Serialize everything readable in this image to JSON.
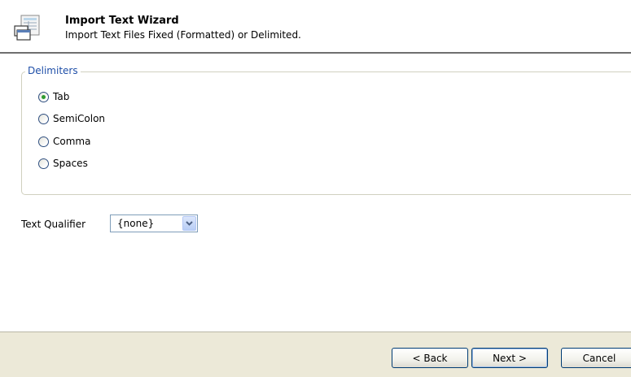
{
  "header": {
    "title": "Import Text Wizard",
    "subtitle": "Import Text Files Fixed (Formatted) or Delimited.",
    "icon": "wizard-icon"
  },
  "delimiters": {
    "legend": "Delimiters",
    "options": [
      {
        "label": "Tab",
        "checked": true
      },
      {
        "label": "SemiColon",
        "checked": false
      },
      {
        "label": "Comma",
        "checked": false
      },
      {
        "label": "Spaces",
        "checked": false
      }
    ]
  },
  "qualifier": {
    "label": "Text Qualifier",
    "value": "{none}"
  },
  "footer": {
    "back_label": "< Back",
    "next_label": "Next >",
    "cancel_label": "Cancel"
  },
  "colors": {
    "legend_text": "#1f4fa8",
    "footer_bg": "#ece9d8",
    "radio_dot": "#2f9b2f"
  }
}
